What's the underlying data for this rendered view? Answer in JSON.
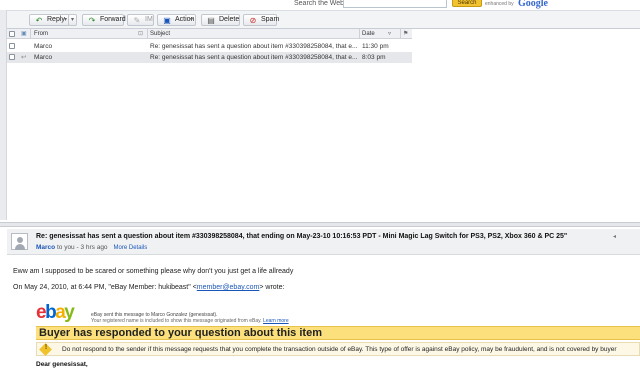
{
  "search": {
    "label": "Search the Web",
    "button": "Search",
    "enhanced_by": "enhanced by",
    "provider": "Google"
  },
  "toolbar": {
    "reply": "Reply",
    "forward": "Forward",
    "im": "IM",
    "action": "Action",
    "delete": "Delete",
    "spam": "Spam"
  },
  "list": {
    "headers": {
      "from": "From",
      "subject": "Subject",
      "date": "Date"
    },
    "rows": [
      {
        "from": "Marco",
        "subject": "Re: genesissat has sent a question about item #330398258084, that e...",
        "date": "11:30 pm"
      },
      {
        "from": "Marco",
        "subject": "Re: genesissat has sent a question about item #330398258084, that e...",
        "date": "8:03 pm"
      }
    ]
  },
  "message": {
    "subject": "Re: genesissat has sent a question about item #330398258084, that ending on May-23-10 10:16:53 PDT - Mini Magic Lag Switch for PS3, PS2, Xbox 360 & PC 25\"",
    "sender": "Marco",
    "meta_rest": " to you - 3 hrs ago",
    "more_details": "More Details",
    "line1": "Eww am I supposed to be scared or something please why don't you just get a life allready",
    "quote_prefix": "On May 24, 2010, at 6:44 PM, \"eBay Member: hukibeast\" <",
    "quote_email": "member@ebay.com",
    "quote_suffix": "> wrote:"
  },
  "ebay": {
    "logo": {
      "e": "e",
      "b": "b",
      "a": "a",
      "y": "y"
    },
    "sent_prefix": "eBay sent this message to Marco Gonzalez (genesissat).",
    "registered": "Your registered name is included to show this message originated from eBay. ",
    "learn_more": "Learn more",
    "banner": "Buyer has responded to your question about this item",
    "warning": "Do not respond to the sender if this message requests that you complete the transaction outside of eBay. This type of offer is against eBay policy, may be fraudulent, and is not covered by buyer",
    "dear": "Dear genesissat,"
  },
  "colors": {
    "accent": "#1a56b8",
    "banner": "#fbe07b",
    "search_button": "#f2c230"
  }
}
